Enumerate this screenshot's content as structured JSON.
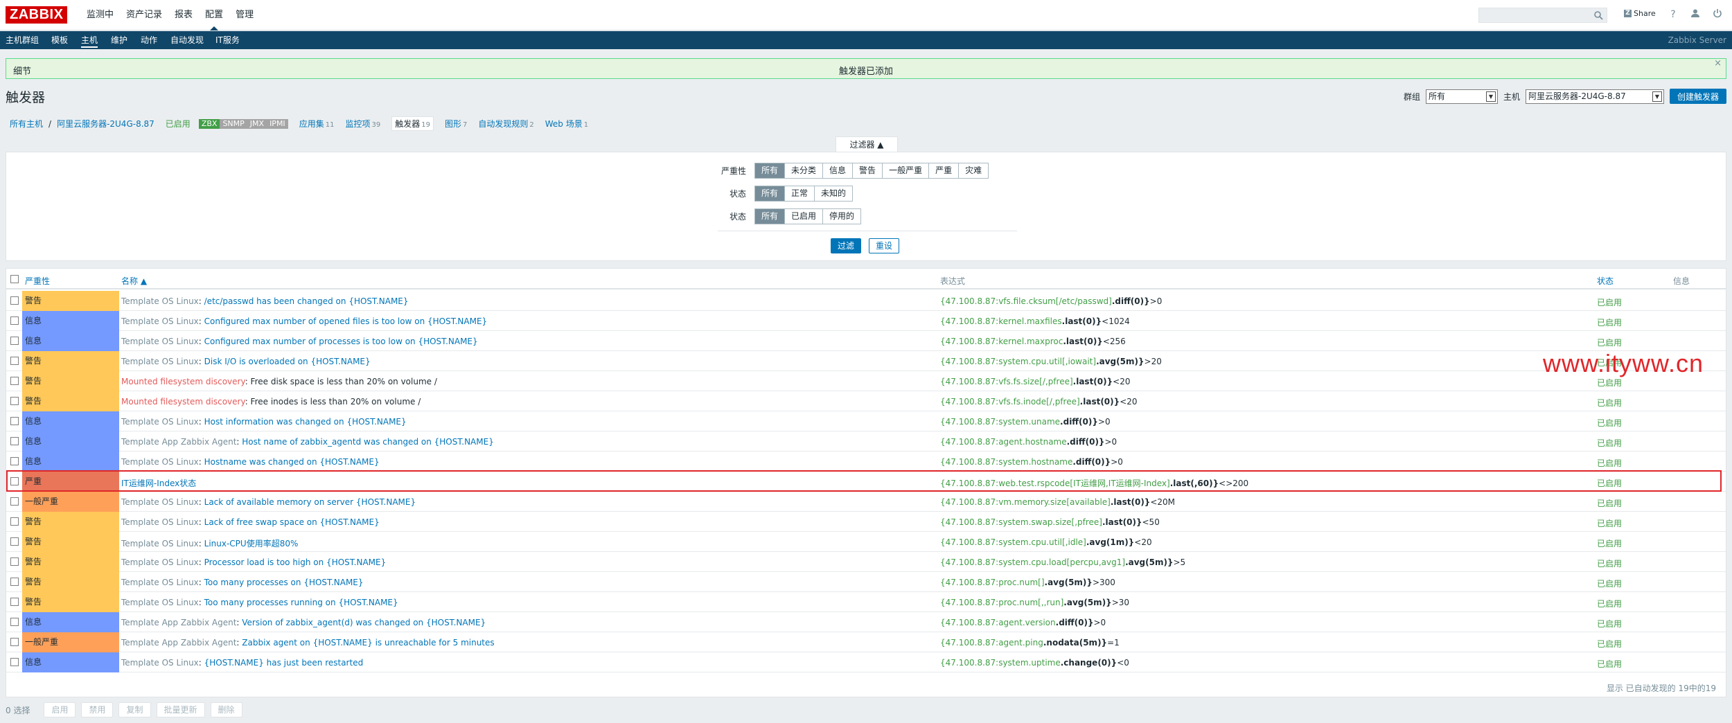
{
  "header": {
    "logo": "ZABBIX",
    "menu": [
      "监测中",
      "资产记录",
      "报表",
      "配置",
      "管理"
    ],
    "active_menu": 3,
    "share": "Share",
    "help_icon": "help-icon",
    "user_icon": "user-icon",
    "power_icon": "power-icon"
  },
  "subnav": {
    "items": [
      "主机群组",
      "模板",
      "主机",
      "维护",
      "动作",
      "自动发现",
      "IT服务"
    ],
    "active": 2,
    "server": "Zabbix Server"
  },
  "message": {
    "details": "细节",
    "text": "触发器已添加",
    "close": "×"
  },
  "page": {
    "title": "触发器",
    "group_label": "群组",
    "group_value": "所有",
    "host_label": "主机",
    "host_value": "阿里云服务器-2U4G-8.87",
    "create_button": "创建触发器"
  },
  "host_nav": {
    "all_hosts": "所有主机",
    "sep": "/",
    "host": "阿里云服务器-2U4G-8.87",
    "enabled": "已启用",
    "availability": [
      "ZBX",
      "SNMP",
      "JMX",
      "IPMI"
    ],
    "applications": "应用集",
    "applications_count": "11",
    "items": "监控项",
    "items_count": "39",
    "triggers": "触发器",
    "triggers_count": "19",
    "graphs": "图形",
    "graphs_count": "7",
    "discovery": "自动发现规则",
    "discovery_count": "2",
    "web": "Web 场景",
    "web_count": "1"
  },
  "filter": {
    "tab_label": "过滤器 ▲",
    "severity_label": "严重性",
    "severity_options": [
      "所有",
      "未分类",
      "信息",
      "警告",
      "一般严重",
      "严重",
      "灾难"
    ],
    "state_label": "状态",
    "state_options": [
      "所有",
      "正常",
      "未知的"
    ],
    "status_label": "状态",
    "status_options": [
      "所有",
      "已启用",
      "停用的"
    ],
    "apply": "过滤",
    "reset": "重设"
  },
  "table": {
    "headers": {
      "severity": "严重性",
      "name": "名称 ▲",
      "expression": "表达式",
      "status": "状态",
      "info": "信息"
    },
    "rows": [
      {
        "severity": "警告",
        "sev_class": "warning",
        "template": "Template OS Linux",
        "name": "/etc/passwd has been changed on {HOST.NAME}",
        "expr_item": "{47.100.8.87:vfs.file.cksum[/etc/passwd]",
        "expr_fn": ".diff(0)}",
        "expr_tail": ">0",
        "status": "已启用"
      },
      {
        "severity": "信息",
        "sev_class": "info",
        "template": "Template OS Linux",
        "name": "Configured max number of opened files is too low on {HOST.NAME}",
        "expr_item": "{47.100.8.87:kernel.maxfiles",
        "expr_fn": ".last(0)}",
        "expr_tail": "<1024",
        "status": "已启用"
      },
      {
        "severity": "信息",
        "sev_class": "info",
        "template": "Template OS Linux",
        "name": "Configured max number of processes is too low on {HOST.NAME}",
        "expr_item": "{47.100.8.87:kernel.maxproc",
        "expr_fn": ".last(0)}",
        "expr_tail": "<256",
        "status": "已启用"
      },
      {
        "severity": "警告",
        "sev_class": "warning",
        "template": "Template OS Linux",
        "name": "Disk I/O is overloaded on {HOST.NAME}",
        "expr_item": "{47.100.8.87:system.cpu.util[,iowait]",
        "expr_fn": ".avg(5m)}",
        "expr_tail": ">20",
        "status": "已启用"
      },
      {
        "severity": "警告",
        "sev_class": "warning",
        "template": "Mounted filesystem discovery",
        "tpl_disc": true,
        "name": "Free disk space is less than 20% on volume /",
        "name_plain": true,
        "expr_item": "{47.100.8.87:vfs.fs.size[/,pfree]",
        "expr_fn": ".last(0)}",
        "expr_tail": "<20",
        "status": "已启用"
      },
      {
        "severity": "警告",
        "sev_class": "warning",
        "template": "Mounted filesystem discovery",
        "tpl_disc": true,
        "name": "Free inodes is less than 20% on volume /",
        "name_plain": true,
        "expr_item": "{47.100.8.87:vfs.fs.inode[/,pfree]",
        "expr_fn": ".last(0)}",
        "expr_tail": "<20",
        "status": "已启用"
      },
      {
        "severity": "信息",
        "sev_class": "info",
        "template": "Template OS Linux",
        "name": "Host information was changed on {HOST.NAME}",
        "expr_item": "{47.100.8.87:system.uname",
        "expr_fn": ".diff(0)}",
        "expr_tail": ">0",
        "status": "已启用"
      },
      {
        "severity": "信息",
        "sev_class": "info",
        "template": "Template App Zabbix Agent",
        "name": "Host name of zabbix_agentd was changed on {HOST.NAME}",
        "expr_item": "{47.100.8.87:agent.hostname",
        "expr_fn": ".diff(0)}",
        "expr_tail": ">0",
        "status": "已启用"
      },
      {
        "severity": "信息",
        "sev_class": "info",
        "template": "Template OS Linux",
        "name": "Hostname was changed on {HOST.NAME}",
        "expr_item": "{47.100.8.87:system.hostname",
        "expr_fn": ".diff(0)}",
        "expr_tail": ">0",
        "status": "已启用"
      },
      {
        "severity": "严重",
        "sev_class": "high",
        "template": "",
        "name": "IT运维网-Index状态",
        "expr_item": "{47.100.8.87:web.test.rspcode[IT运维网,IT运维网-Index]",
        "expr_fn": ".last(,60)}",
        "expr_tail": "<>200",
        "status": "已启用",
        "highlight": true
      },
      {
        "severity": "一般严重",
        "sev_class": "average",
        "template": "Template OS Linux",
        "name": "Lack of available memory on server {HOST.NAME}",
        "expr_item": "{47.100.8.87:vm.memory.size[available]",
        "expr_fn": ".last(0)}",
        "expr_tail": "<20M",
        "status": "已启用"
      },
      {
        "severity": "警告",
        "sev_class": "warning",
        "template": "Template OS Linux",
        "name": "Lack of free swap space on {HOST.NAME}",
        "expr_item": "{47.100.8.87:system.swap.size[,pfree]",
        "expr_fn": ".last(0)}",
        "expr_tail": "<50",
        "status": "已启用"
      },
      {
        "severity": "警告",
        "sev_class": "warning",
        "template": "Template OS Linux",
        "name": "Linux-CPU使用率超80%",
        "expr_item": "{47.100.8.87:system.cpu.util[,idle]",
        "expr_fn": ".avg(1m)}",
        "expr_tail": "<20",
        "status": "已启用"
      },
      {
        "severity": "警告",
        "sev_class": "warning",
        "template": "Template OS Linux",
        "name": "Processor load is too high on {HOST.NAME}",
        "expr_item": "{47.100.8.87:system.cpu.load[percpu,avg1]",
        "expr_fn": ".avg(5m)}",
        "expr_tail": ">5",
        "status": "已启用"
      },
      {
        "severity": "警告",
        "sev_class": "warning",
        "template": "Template OS Linux",
        "name": "Too many processes on {HOST.NAME}",
        "expr_item": "{47.100.8.87:proc.num[]",
        "expr_fn": ".avg(5m)}",
        "expr_tail": ">300",
        "status": "已启用"
      },
      {
        "severity": "警告",
        "sev_class": "warning",
        "template": "Template OS Linux",
        "name": "Too many processes running on {HOST.NAME}",
        "expr_item": "{47.100.8.87:proc.num[,,run]",
        "expr_fn": ".avg(5m)}",
        "expr_tail": ">30",
        "status": "已启用"
      },
      {
        "severity": "信息",
        "sev_class": "info",
        "template": "Template App Zabbix Agent",
        "name": "Version of zabbix_agent(d) was changed on {HOST.NAME}",
        "expr_item": "{47.100.8.87:agent.version",
        "expr_fn": ".diff(0)}",
        "expr_tail": ">0",
        "status": "已启用"
      },
      {
        "severity": "一般严重",
        "sev_class": "average",
        "template": "Template App Zabbix Agent",
        "name": "Zabbix agent on {HOST.NAME} is unreachable for 5 minutes",
        "expr_item": "{47.100.8.87:agent.ping",
        "expr_fn": ".nodata(5m)}",
        "expr_tail": "=1",
        "status": "已启用"
      },
      {
        "severity": "信息",
        "sev_class": "info",
        "template": "Template OS Linux",
        "name": "{HOST.NAME} has just been restarted",
        "expr_item": "{47.100.8.87:system.uptime",
        "expr_fn": ".change(0)}",
        "expr_tail": "<0",
        "status": "已启用"
      }
    ],
    "footer": "显示 已自动发现的 19中的19"
  },
  "watermark": "www.ityww.cn",
  "actions": {
    "selected": "0 选择",
    "buttons": [
      "启用",
      "禁用",
      "复制",
      "批量更新",
      "删除"
    ]
  },
  "colors": {
    "warning": "#ffc859",
    "info": "#7499ff",
    "high": "#e97659",
    "average": "#ffa059",
    "nav_bg": "#104668",
    "link": "#0275b8",
    "enabled": "#429e47"
  }
}
